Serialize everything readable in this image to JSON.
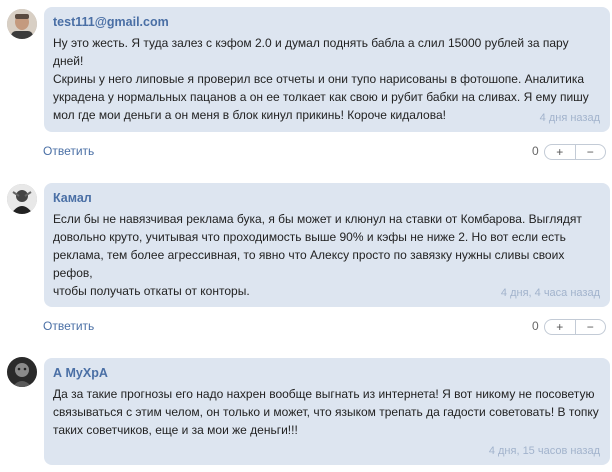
{
  "comments": [
    {
      "author": "test111@gmail.com",
      "text": "Ну это жесть. Я туда залез с кэфом 2.0 и думал поднять бабла а слил 15000 рублей за пару дней!\nСкрины у него липовые я проверил все отчеты и они тупо нарисованы в фотошопе. Аналитика\nукрадена у нормальных пацанов а он ее толкает как свою и рубит бабки на сливах. Я ему пишу\nмол где мои деньги а он меня в блок кинул прикинь! Короче кидалова!",
      "time": "4 дня назад",
      "reply_label": "Ответить",
      "score": "0",
      "plus": "+",
      "minus": "−"
    },
    {
      "author": "Камал",
      "text": "Если бы не навязчивая реклама бука, я бы может и клюнул на ставки от Комбарова. Выглядят\nдовольно круто, учитывая что проходимость выше 90% и кэфы не ниже 2. Но вот если есть\nреклама, тем более агрессивная, то явно что Алексу просто по завязку нужны сливы своих рефов,\nчтобы получать откаты от конторы.",
      "time": "4 дня, 4 часа назад",
      "reply_label": "Ответить",
      "score": "0",
      "plus": "+",
      "minus": "−"
    },
    {
      "author": "А МуХрА",
      "text": "Да за такие прогнозы его надо нахрен вообще выгнать из интернета! Я вот никому не посоветую\nсвязываться с этим челом, он только и может, что языком трепать да гадости советовать! В топку\nтаких советчиков, еще и за мои же деньги!!!",
      "time": "4 дня, 15 часов назад"
    }
  ],
  "colors": {
    "bubble": "#dde5f0",
    "author": "#4a6fa5",
    "time": "#a2b3cc",
    "link": "#4a6fa5"
  }
}
